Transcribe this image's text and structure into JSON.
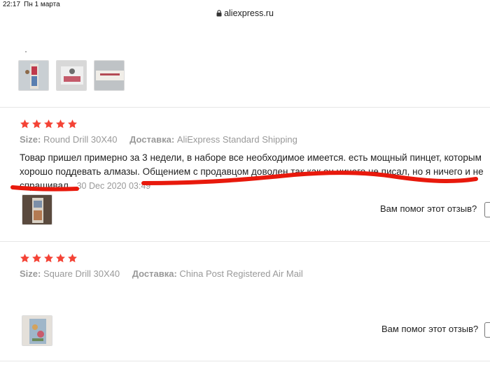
{
  "status_bar": {
    "time": "22:17",
    "date": "Пн 1 марта"
  },
  "browser": {
    "url": "aliexpress.ru"
  },
  "reviews": [
    {
      "rating": 5,
      "size_label": "Size:",
      "size_value": "Round Drill 30X40",
      "shipping_label": "Доставка:",
      "shipping_value": "AliExpress Standard Shipping",
      "text": "Товар пришел примерно за 3 недели, в наборе все необходимое имеется. есть мощный пинцет, которым хорошо поддевать алмазы. Общением с продавцом доволен так как он ничего не писал, но я ничего и не спрашивал.",
      "date": "30 Dec 2020 03:49",
      "helpful_question": "Вам помог этот отзыв?"
    },
    {
      "rating": 5,
      "size_label": "Size:",
      "size_value": "Square Drill 30X40",
      "shipping_label": "Доставка:",
      "shipping_value": "China Post Registered Air Mail",
      "helpful_question": "Вам помог этот отзыв?"
    }
  ],
  "colors": {
    "star": "#f44336",
    "annotation": "#e8190c",
    "meta": "#999999"
  },
  "icons": [
    "lock-icon",
    "star-icon"
  ]
}
